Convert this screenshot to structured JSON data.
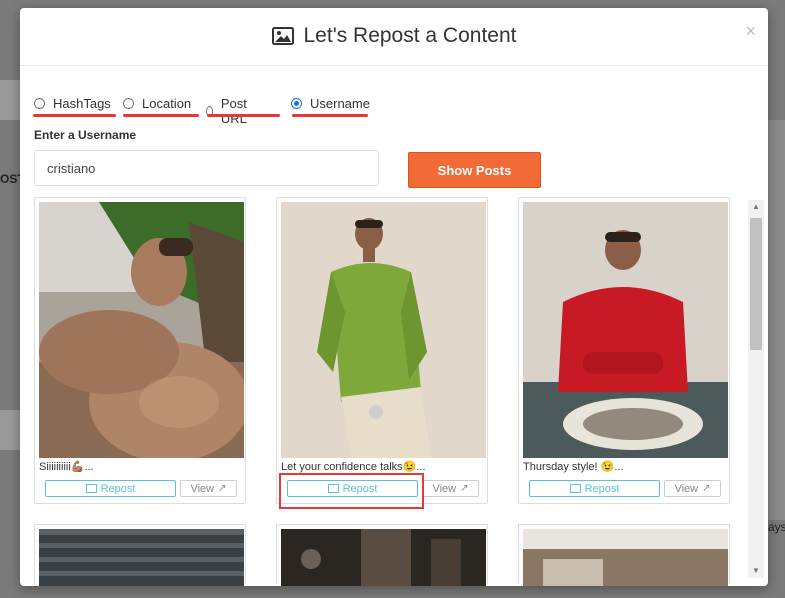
{
  "modal": {
    "title": "Let's Repost a Content",
    "close_label": "×"
  },
  "options": [
    {
      "label": "HashTags",
      "checked": false
    },
    {
      "label": "Location",
      "checked": false
    },
    {
      "label": "Post URL",
      "checked": false
    },
    {
      "label": "Username",
      "checked": true
    }
  ],
  "form": {
    "label": "Enter a Username",
    "value": "cristiano",
    "submit_label": "Show Posts"
  },
  "posts": [
    {
      "caption": "Siiiiiiiiii💪🏽...",
      "repost_label": "Repost",
      "view_label": "View"
    },
    {
      "caption": "Let your confidence talks😉...",
      "repost_label": "Repost",
      "view_label": "View"
    },
    {
      "caption": "Thursday style! 😉...",
      "repost_label": "Repost",
      "view_label": "View"
    }
  ],
  "background": {
    "left_label": "OST",
    "right_label": "ays"
  },
  "colors": {
    "accent": "#f26a36",
    "repost": "#5bc0de",
    "annotation": "#e53935",
    "radio_checked": "#1a73e8"
  }
}
